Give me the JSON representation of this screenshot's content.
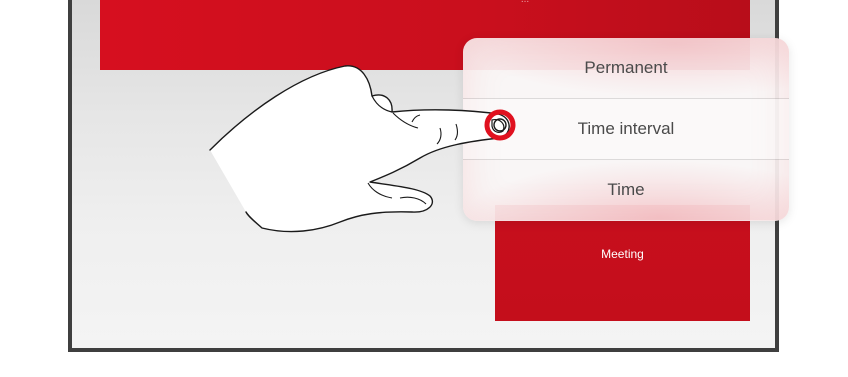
{
  "screen": {
    "banner_caption": "...",
    "meeting_tile": {
      "label": "Meeting"
    },
    "popover": {
      "items": [
        {
          "label": "Permanent"
        },
        {
          "label": "Time interval"
        },
        {
          "label": "Time"
        }
      ],
      "highlighted_index": 1
    }
  },
  "overlay": {
    "gesture": "tap",
    "icon": "pointing-hand-icon",
    "tap_indicator_icon": "tap-ring-icon"
  },
  "colors": {
    "brand_red": "#c90f1d",
    "tap_ring": "#e0111f",
    "frame_border": "#3f3f3f",
    "menu_text": "#4a4a4a"
  }
}
